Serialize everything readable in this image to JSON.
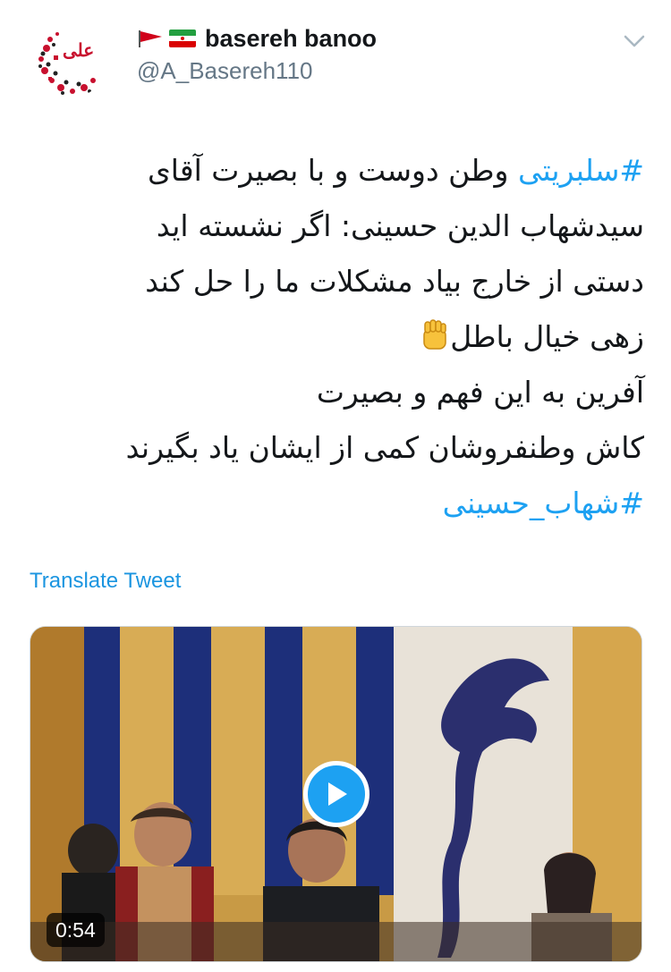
{
  "tweet": {
    "author": {
      "display_name": "basereh banoo",
      "handle": "@A_Basereh110",
      "avatar_text": "علی",
      "name_emojis": [
        "red-triangular-flag-icon",
        "iran-flag-icon"
      ]
    },
    "lines": [
      {
        "hashtag": "#سلبریتی",
        "text": " وطن دوست و با بصیرت آقای"
      },
      {
        "text": "سیدشهاب الدین حسینی: اگر نشسته اید"
      },
      {
        "text": "دستی از خارج بیاد مشکلات ما را حل کند"
      },
      {
        "text": "زهی خیال باطل",
        "emoji": "raised-fist-icon"
      },
      {
        "text": "آفرین به این فهم و بصیرت"
      },
      {
        "text": "کاش وطنفروشان کمی از ایشان یاد بگیرند"
      },
      {
        "hashtag": "#شهاب_حسینی"
      }
    ],
    "translate_label": "Translate Tweet",
    "media": {
      "type": "video",
      "duration": "0:54"
    }
  },
  "colors": {
    "accent": "#1da1f2",
    "link": "#1b95e0",
    "text": "#14171a",
    "secondary": "#657786"
  }
}
